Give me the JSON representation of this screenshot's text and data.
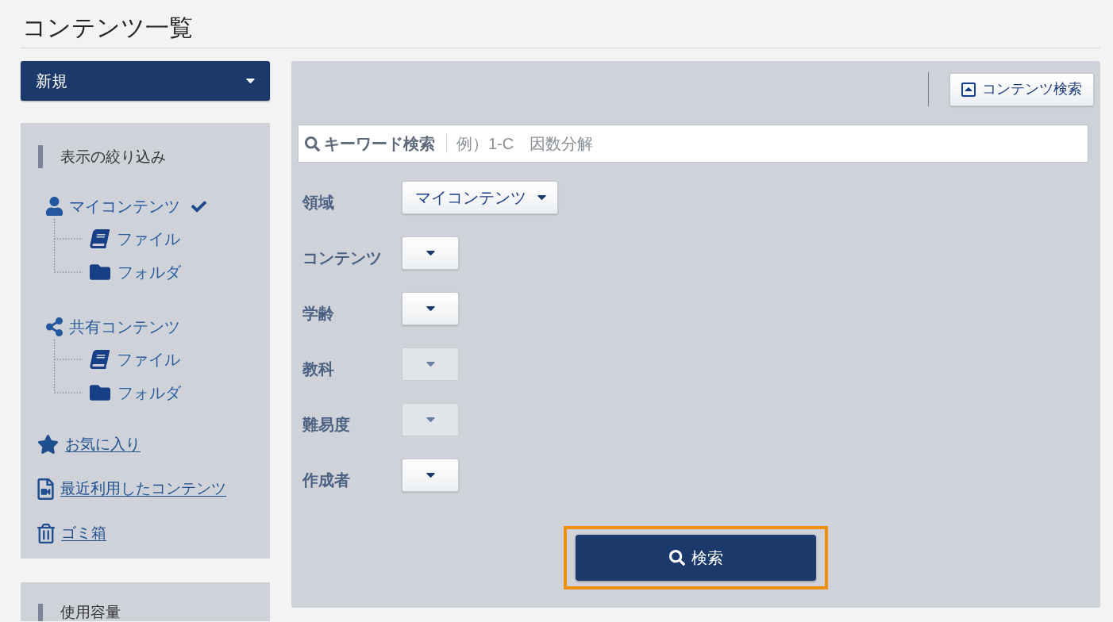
{
  "page_title": "コンテンツ一覧",
  "new_button": {
    "label": "新規"
  },
  "filter_panel": {
    "heading": "表示の絞り込み",
    "tree": [
      {
        "kind": "user",
        "label": "マイコンテンツ",
        "selected": true,
        "children": [
          {
            "kind": "file",
            "label": "ファイル"
          },
          {
            "kind": "folder",
            "label": "フォルダ"
          }
        ]
      },
      {
        "kind": "shared",
        "label": "共有コンテンツ",
        "selected": false,
        "children": [
          {
            "kind": "file",
            "label": "ファイル"
          },
          {
            "kind": "folder",
            "label": "フォルダ"
          }
        ]
      }
    ],
    "links": [
      {
        "kind": "star",
        "label": "お気に入り"
      },
      {
        "kind": "recent",
        "label": "最近利用したコンテンツ"
      },
      {
        "kind": "trash",
        "label": "ゴミ箱"
      }
    ]
  },
  "usage_panel": {
    "heading": "使用容量"
  },
  "search_panel": {
    "toggle_button": {
      "label": "コンテンツ検索"
    },
    "keyword_field": {
      "label": "キーワード検索",
      "placeholder": "例）1-C　因数分解"
    },
    "filters": [
      {
        "label": "領域",
        "value": "マイコンテンツ",
        "disabled": false
      },
      {
        "label": "コンテンツ",
        "disabled": false
      },
      {
        "label": "学齢",
        "disabled": false
      },
      {
        "label": "教科",
        "disabled": true
      },
      {
        "label": "難易度",
        "disabled": true
      },
      {
        "label": "作成者",
        "disabled": false
      }
    ],
    "search_button": {
      "label": "検索",
      "focused": true
    }
  }
}
